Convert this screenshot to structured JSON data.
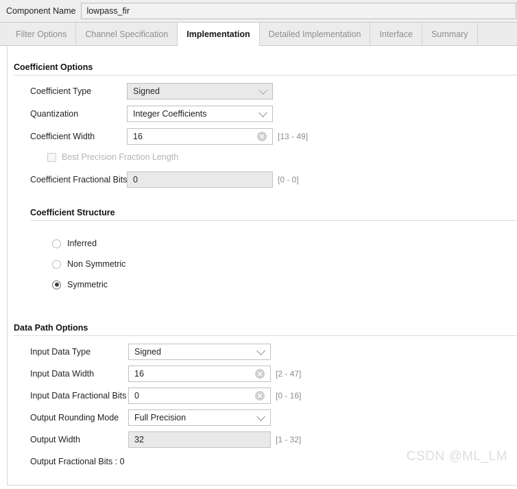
{
  "header": {
    "component_name_label": "Component Name",
    "component_name_value": "lowpass_fir"
  },
  "tabs": [
    {
      "label": "Filter Options",
      "active": false
    },
    {
      "label": "Channel Specification",
      "active": false
    },
    {
      "label": "Implementation",
      "active": true
    },
    {
      "label": "Detailed Implementation",
      "active": false
    },
    {
      "label": "Interface",
      "active": false
    },
    {
      "label": "Summary",
      "active": false
    }
  ],
  "coefficient_options": {
    "title": "Coefficient Options",
    "coefficient_type": {
      "label": "Coefficient Type",
      "value": "Signed",
      "icon": "chevron-down-icon"
    },
    "quantization": {
      "label": "Quantization",
      "value": "Integer Coefficients",
      "icon": "chevron-down-icon"
    },
    "coefficient_width": {
      "label": "Coefficient Width",
      "value": "16",
      "range": "[13 - 49]",
      "icon": "clear-icon"
    },
    "best_precision": {
      "label": "Best Precision Fraction Length"
    },
    "coefficient_fractional_bits": {
      "label": "Coefficient Fractional Bits",
      "value": "0",
      "range": "[0 - 0]"
    }
  },
  "coefficient_structure": {
    "title": "Coefficient Structure",
    "options": [
      {
        "label": "Inferred",
        "selected": false
      },
      {
        "label": "Non Symmetric",
        "selected": false
      },
      {
        "label": "Symmetric",
        "selected": true
      }
    ]
  },
  "data_path_options": {
    "title": "Data Path Options",
    "input_data_type": {
      "label": "Input Data Type",
      "value": "Signed",
      "icon": "chevron-down-icon"
    },
    "input_data_width": {
      "label": "Input Data Width",
      "value": "16",
      "range": "[2 - 47]",
      "icon": "clear-icon"
    },
    "input_data_fractional_bits": {
      "label": "Input Data Fractional Bits",
      "value": "0",
      "range": "[0 - 16]",
      "icon": "clear-icon"
    },
    "output_rounding_mode": {
      "label": "Output Rounding Mode",
      "value": "Full Precision",
      "icon": "chevron-down-icon"
    },
    "output_width": {
      "label": "Output Width",
      "value": "32",
      "range": "[1 - 32]"
    },
    "output_fractional_bits_text": "Output Fractional Bits : 0"
  },
  "watermark": "CSDN @ML_LM"
}
